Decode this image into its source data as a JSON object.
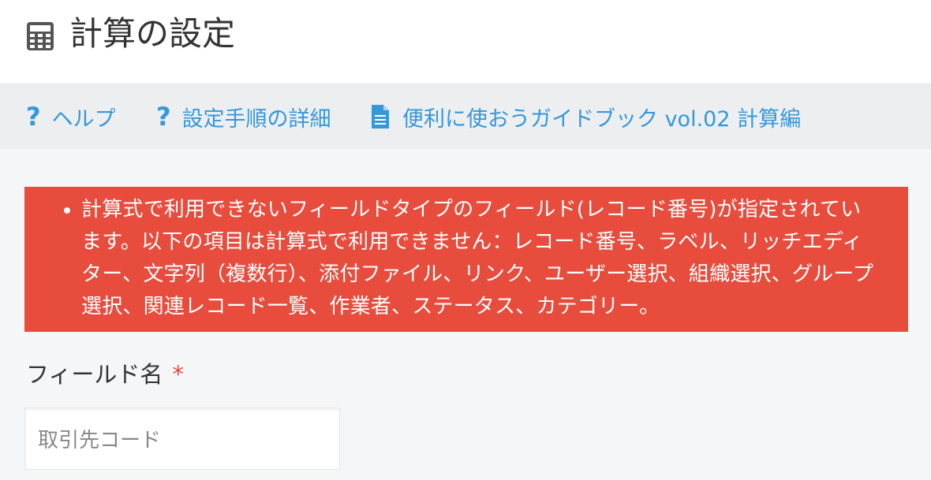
{
  "header": {
    "icon": "calculator-icon",
    "title": "計算の設定"
  },
  "helpbar": {
    "links": [
      {
        "icon": "question-icon",
        "label": "ヘルプ"
      },
      {
        "icon": "question-icon",
        "label": "設定手順の詳細"
      },
      {
        "icon": "document-icon",
        "label": "便利に使おうガイドブック vol.02 計算編"
      }
    ]
  },
  "error": {
    "message": "計算式で利用できないフィールドタイプのフィールド(レコード番号)が指定されています。以下の項目は計算式で利用できません：レコード番号、ラベル、リッチエディター、文字列（複数行）、添付ファイル、リンク、ユーザー選択、組織選択、グループ選択、関連レコード一覧、作業者、ステータス、カテゴリー。"
  },
  "field": {
    "label": "フィールド名",
    "required_mark": "*",
    "value": "取引先コード"
  },
  "colors": {
    "accent": "#3498db",
    "error_bg": "#e74c3c",
    "required": "#e74c3c"
  }
}
